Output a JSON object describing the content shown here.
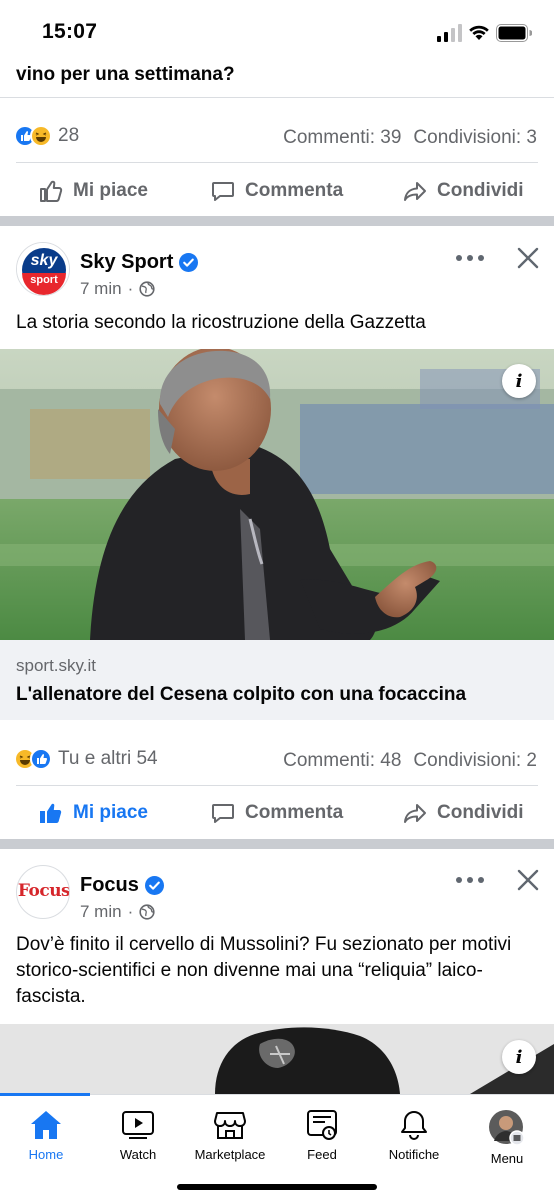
{
  "status_bar": {
    "time": "15:07"
  },
  "prev_post": {
    "title_tail": "vino per una settimana?",
    "reactions_count": "28",
    "comments": "Commenti: 39",
    "shares": "Condivisioni: 3"
  },
  "actions": {
    "like": "Mi piace",
    "comment": "Commenta",
    "share": "Condividi"
  },
  "post1": {
    "page_name": "Sky Sport",
    "time": "7 min",
    "text": "La storia secondo la ricostruzione della Gazzetta",
    "link_domain": "sport.sky.it",
    "link_title": "L'allenatore del Cesena colpito con una focaccina",
    "reactions_text": "Tu e altri 54",
    "comments": "Commenti: 48",
    "shares": "Condivisioni: 2",
    "liked": true
  },
  "post2": {
    "page_name": "Focus",
    "time": "7 min",
    "text": "Dov’è finito il cervello di Mussolini? Fu sezionato per motivi storico-scientifici e non divenne mai una “reliquia” laico-fascista.",
    "logo_text": "Focus"
  },
  "sky_logo": {
    "top": "sky",
    "bottom": "sport"
  },
  "tabs": [
    {
      "label": "Home",
      "icon": "home-icon",
      "active": true
    },
    {
      "label": "Watch",
      "icon": "watch-icon"
    },
    {
      "label": "Marketplace",
      "icon": "marketplace-icon"
    },
    {
      "label": "Feed",
      "icon": "feed-icon"
    },
    {
      "label": "Notifiche",
      "icon": "bell-icon"
    },
    {
      "label": "Menu",
      "icon": "profile-avatar-icon"
    }
  ],
  "colors": {
    "accent": "#1877f2",
    "muted": "#65676b",
    "separator": "#c9ccd1"
  }
}
